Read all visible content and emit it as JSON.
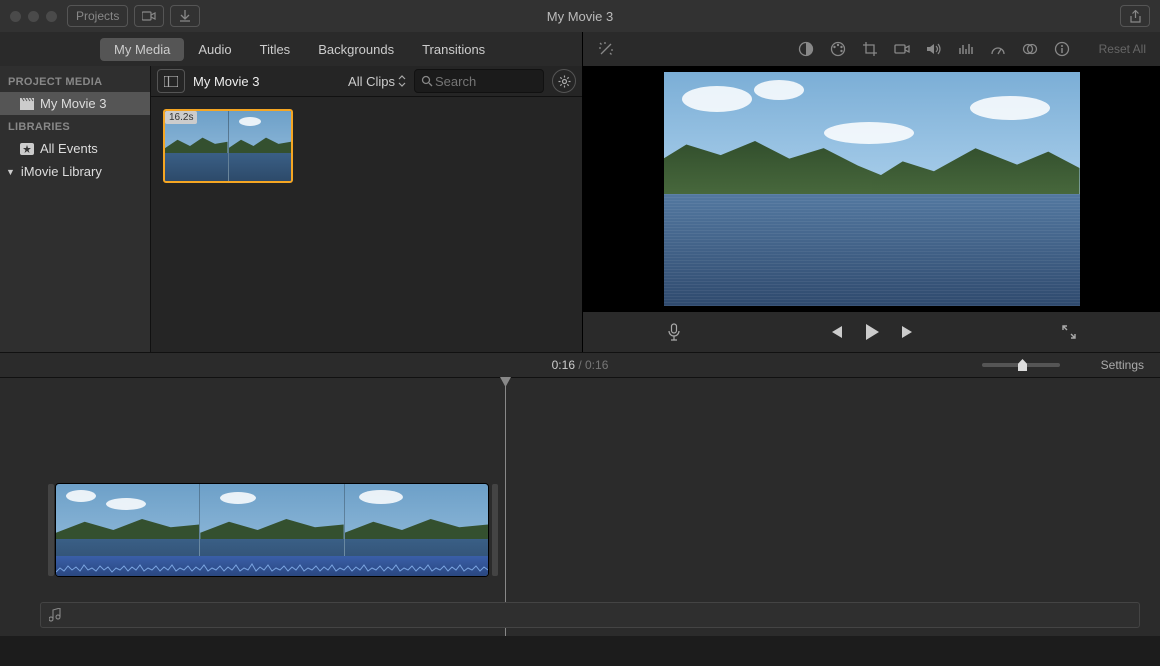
{
  "window": {
    "title": "My Movie 3",
    "projects_button": "Projects"
  },
  "tabs": {
    "my_media": "My Media",
    "audio": "Audio",
    "titles": "Titles",
    "backgrounds": "Backgrounds",
    "transitions": "Transitions"
  },
  "sidebar": {
    "project_media_hdr": "PROJECT MEDIA",
    "project_item": "My Movie 3",
    "libraries_hdr": "LIBRARIES",
    "all_events": "All Events",
    "imovie_library": "iMovie Library"
  },
  "content_header": {
    "title": "My Movie 3",
    "filter": "All Clips",
    "search_placeholder": "Search"
  },
  "clip": {
    "duration": "16.2s"
  },
  "viewer": {
    "reset": "Reset All"
  },
  "timecode": {
    "current": "0:16",
    "separator": " / ",
    "total": "0:16"
  },
  "settings_label": "Settings"
}
